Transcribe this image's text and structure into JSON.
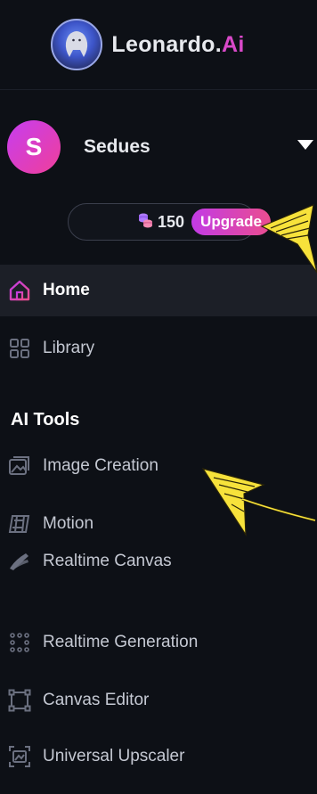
{
  "brand": {
    "name_main": "Leonardo.",
    "name_accent": "Ai"
  },
  "user": {
    "initial": "S",
    "name": "Sedues"
  },
  "credits": {
    "count": "150",
    "upgrade_label": "Upgrade"
  },
  "nav": {
    "home": "Home",
    "library": "Library"
  },
  "ai_tools": {
    "title": "AI Tools",
    "items": [
      {
        "label": "Image Creation",
        "icon": "image-icon"
      },
      {
        "label": "Motion",
        "icon": "film-icon"
      },
      {
        "label": "Realtime Canvas",
        "icon": "brush-icon"
      },
      {
        "label": "Realtime Generation",
        "icon": "dots-grid-icon"
      },
      {
        "label": "Canvas Editor",
        "icon": "canvas-frame-icon"
      },
      {
        "label": "Universal Upscaler",
        "icon": "upscale-icon"
      }
    ]
  },
  "colors": {
    "background": "#0d1016",
    "accent_pink": "#d949c9",
    "upgrade_gradient_start": "#c23be6",
    "upgrade_gradient_end": "#ea4d8f",
    "annotation_yellow": "#f7e23b"
  }
}
